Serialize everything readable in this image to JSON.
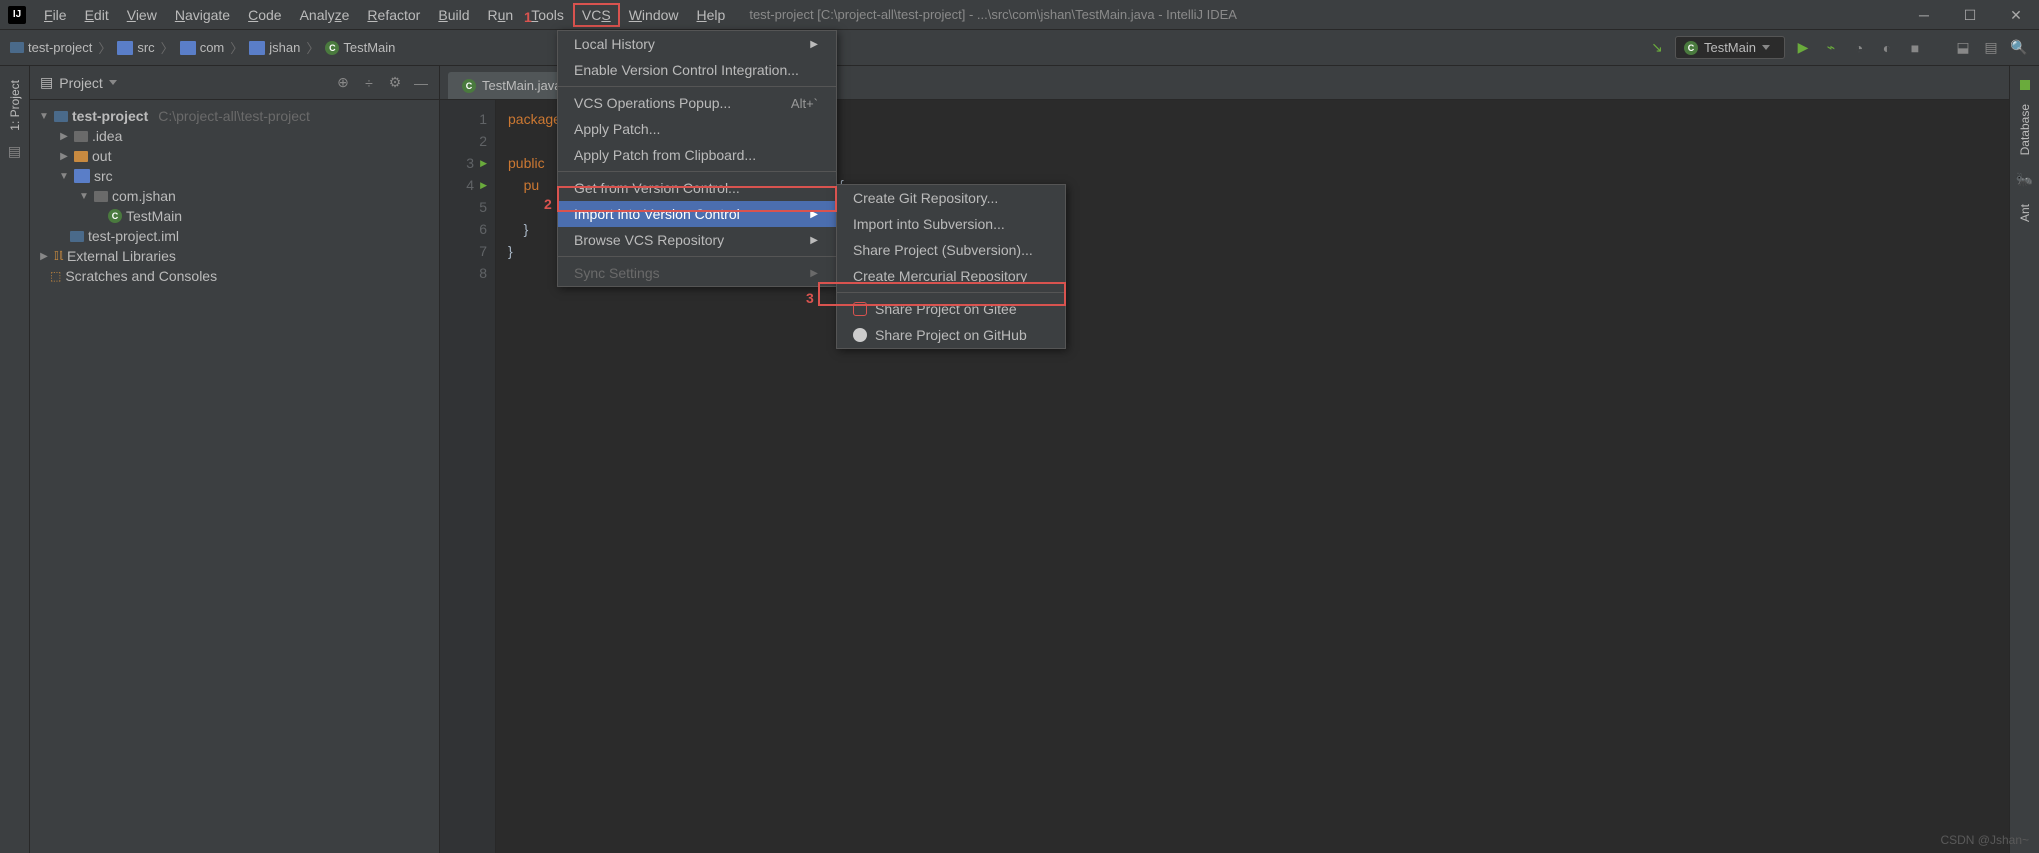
{
  "app": {
    "icon_text": "IJ",
    "title": "test-project [C:\\project-all\\test-project] - ...\\src\\com\\jshan\\TestMain.java - IntelliJ IDEA"
  },
  "menubar": [
    "File",
    "Edit",
    "View",
    "Navigate",
    "Code",
    "Analyze",
    "Refactor",
    "Build",
    "Run",
    "Tools",
    "VCS",
    "Window",
    "Help"
  ],
  "breadcrumb": {
    "items": [
      "test-project",
      "src",
      "com",
      "jshan",
      "TestMain"
    ]
  },
  "run_config": {
    "label": "TestMain"
  },
  "project_panel": {
    "title": "Project",
    "tree": {
      "root": {
        "name": "test-project",
        "hint": "C:\\project-all\\test-project"
      },
      "idea": ".idea",
      "out": "out",
      "src": "src",
      "pkg": "com.jshan",
      "main": "TestMain",
      "iml": "test-project.iml",
      "libs": "External Libraries",
      "scratch": "Scratches and Consoles"
    }
  },
  "editor": {
    "tab": "TestMain.java",
    "lines": [
      "1",
      "2",
      "3",
      "4",
      "5",
      "6",
      "7",
      "8"
    ],
    "code": {
      "l1": "package",
      "l3": "public",
      "l4a": "pu",
      "l4b": "{",
      "l5": "",
      "l6": "}",
      "l7": "}"
    }
  },
  "vcs_menu": {
    "local_history": "Local History",
    "enable_vcs": "Enable Version Control Integration...",
    "operations_popup": "VCS Operations Popup...",
    "operations_shortcut": "Alt+`",
    "apply_patch": "Apply Patch...",
    "apply_patch_clip": "Apply Patch from Clipboard...",
    "get_from_vc": "Get from Version Control...",
    "import_vc": "Import into Version Control",
    "browse_repo": "Browse VCS Repository",
    "sync": "Sync Settings"
  },
  "import_menu": {
    "git_repo": "Create Git Repository...",
    "svn_import": "Import into Subversion...",
    "svn_share": "Share Project (Subversion)...",
    "hg_repo": "Create Mercurial Repository",
    "gitee": "Share Project on Gitee",
    "github": "Share Project on GitHub"
  },
  "annotations": {
    "a1": "1",
    "a2": "2",
    "a3": "3"
  },
  "right_tools": {
    "database": "Database",
    "ant": "Ant"
  },
  "left_tools": {
    "project": "1: Project"
  },
  "watermark": "CSDN @Jshan~"
}
